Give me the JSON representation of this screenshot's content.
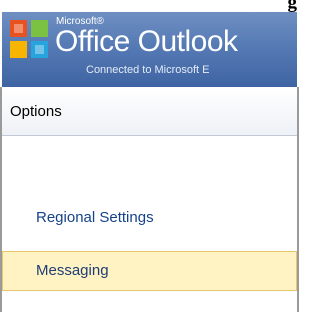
{
  "caption": {
    "text": "g"
  },
  "banner": {
    "brand_small": "Microsoft®",
    "product_name": "Office Outlook",
    "connection_status": "Connected to Microsoft E"
  },
  "options": {
    "title": "Options"
  },
  "nav": {
    "items": [
      {
        "label": "Regional Settings",
        "selected": false
      },
      {
        "label": "Messaging",
        "selected": true
      }
    ]
  },
  "colors": {
    "banner": "#557ab4",
    "link": "#15428b",
    "selected_background": "#fff3c4",
    "selected_border": "#e8c66a"
  }
}
